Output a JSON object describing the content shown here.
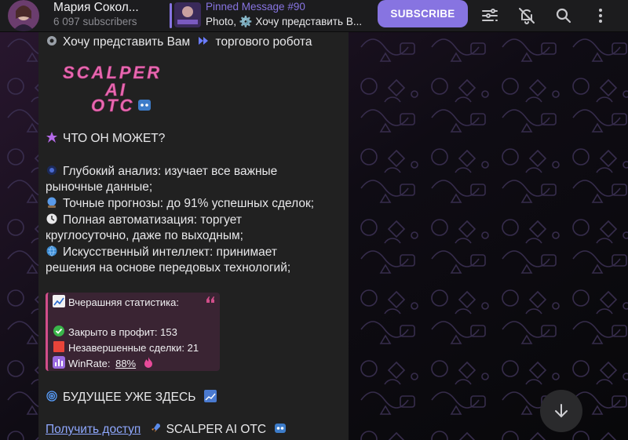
{
  "header": {
    "channel_name": "Мария Сокол...",
    "subscribers": "6 097 subscribers",
    "pinned_title": "Pinned Message #90",
    "pinned_text": "Photo, ⚙️ Хочу представить В...",
    "subscribe_label": "SUBSCRIBE"
  },
  "message": {
    "intro_before": "Хочу представить Вам",
    "intro_after": "торгового робота",
    "logo_line1": "SCALPER",
    "logo_line2": "AI",
    "logo_line3": "OTC",
    "what_can": "ЧТО ОН МОЖЕТ?",
    "f1a": "Глубокий анализ: изучает все важные",
    "f1b": "рыночные данные;",
    "f2": "Точные прогнозы: до 91% успешных сделок;",
    "f3a": "Полная автоматизация: торгует",
    "f3b": "круглосуточно, даже по выходным;",
    "f4a": "Искусственный интеллект: принимает",
    "f4b": "решения на основе передовых технологий;",
    "stats": {
      "title": "Вчерашняя статистика:",
      "closed": "Закрыто в профит: 153",
      "open": "Незавершенные сделки: 21",
      "winrate_label": "WinRate:",
      "winrate_value": "88%"
    },
    "future": "БУДУЩЕЕ УЖЕ ЗДЕСЬ",
    "access_link": "Получить доступ",
    "bot_name": "SCALPER AI OTC"
  },
  "colors": {
    "accent": "#8774e1",
    "bubble": "#212121",
    "link": "#8fa8ff"
  },
  "icons": [
    "filter-icon",
    "bell-off-icon",
    "search-icon",
    "more-vertical-icon",
    "arrow-down-icon"
  ]
}
